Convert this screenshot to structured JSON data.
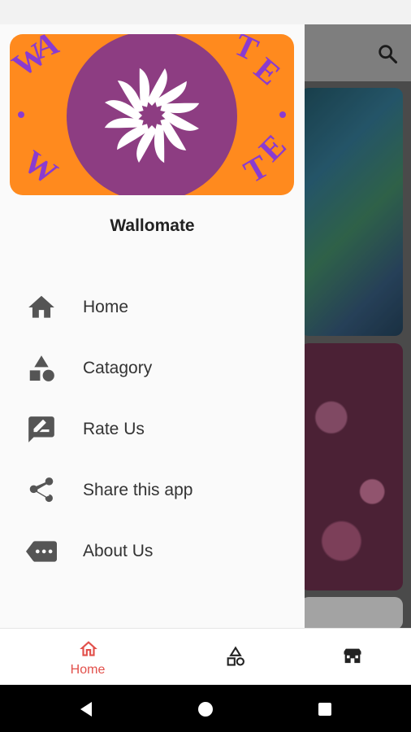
{
  "drawer": {
    "app_name": "Wallomate",
    "menu": [
      {
        "label": "Home",
        "icon": "home-icon"
      },
      {
        "label": "Catagory",
        "icon": "category-icon"
      },
      {
        "label": "Rate Us",
        "icon": "rate-review-icon"
      },
      {
        "label": "Share this app",
        "icon": "share-icon"
      },
      {
        "label": "About Us",
        "icon": "more-icon"
      }
    ]
  },
  "bottom_nav": {
    "home_label": "Home",
    "active_color": "#e2504b"
  },
  "colors": {
    "banner_orange": "#ff8a1e",
    "banner_purple": "#8d3d82"
  }
}
